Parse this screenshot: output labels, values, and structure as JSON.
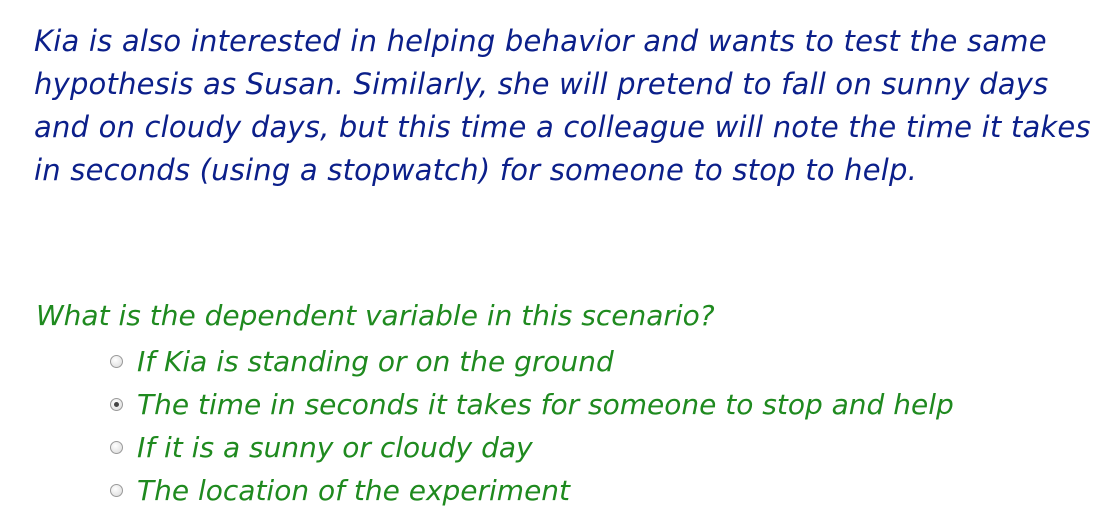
{
  "scenario": {
    "text": "Kia is also interested in helping behavior and wants to test the same hypothesis as Susan. Similarly, she will pretend to fall on sunny days and on cloudy days, but this time a colleague will note the time it takes in seconds (using a stopwatch) for someone to stop to help."
  },
  "question": {
    "text": "What is the dependent variable in this scenario?"
  },
  "options": [
    {
      "label": "If Kia is standing or on the ground",
      "selected": false
    },
    {
      "label": "The time in seconds it takes for someone to stop and help",
      "selected": true
    },
    {
      "label": "If it is a sunny or cloudy day",
      "selected": false
    },
    {
      "label": "The location of the experiment",
      "selected": false
    }
  ],
  "colors": {
    "scenario_text": "#0b1f8a",
    "question_text": "#1f8a1f"
  }
}
